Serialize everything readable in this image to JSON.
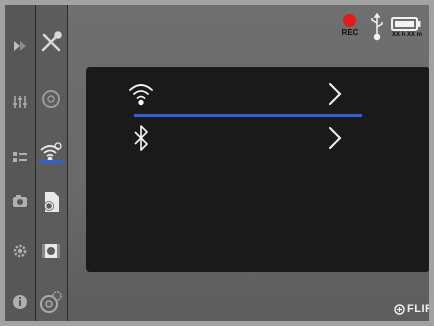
{
  "status_bar": {
    "rec_label": "REC",
    "battery_label": "XX h XX m",
    "rec_color": "#e01b1b"
  },
  "menu": {
    "items": [
      {
        "icon": "wifi-icon",
        "selected": true
      },
      {
        "icon": "bluetooth-icon",
        "selected": false
      }
    ],
    "selection_color": "#2d63d6"
  },
  "rail_far": [
    "play-icon",
    "sliders-icon",
    "list-icon",
    "camera-icon",
    "gear-icon",
    "info-icon"
  ],
  "rail_near": [
    "tools-icon",
    "measure-icon",
    "wifi-settings-icon",
    "file-settings-icon",
    "video-settings-icon",
    "camera-settings-icon"
  ],
  "brand": {
    "name": "FLIR"
  }
}
